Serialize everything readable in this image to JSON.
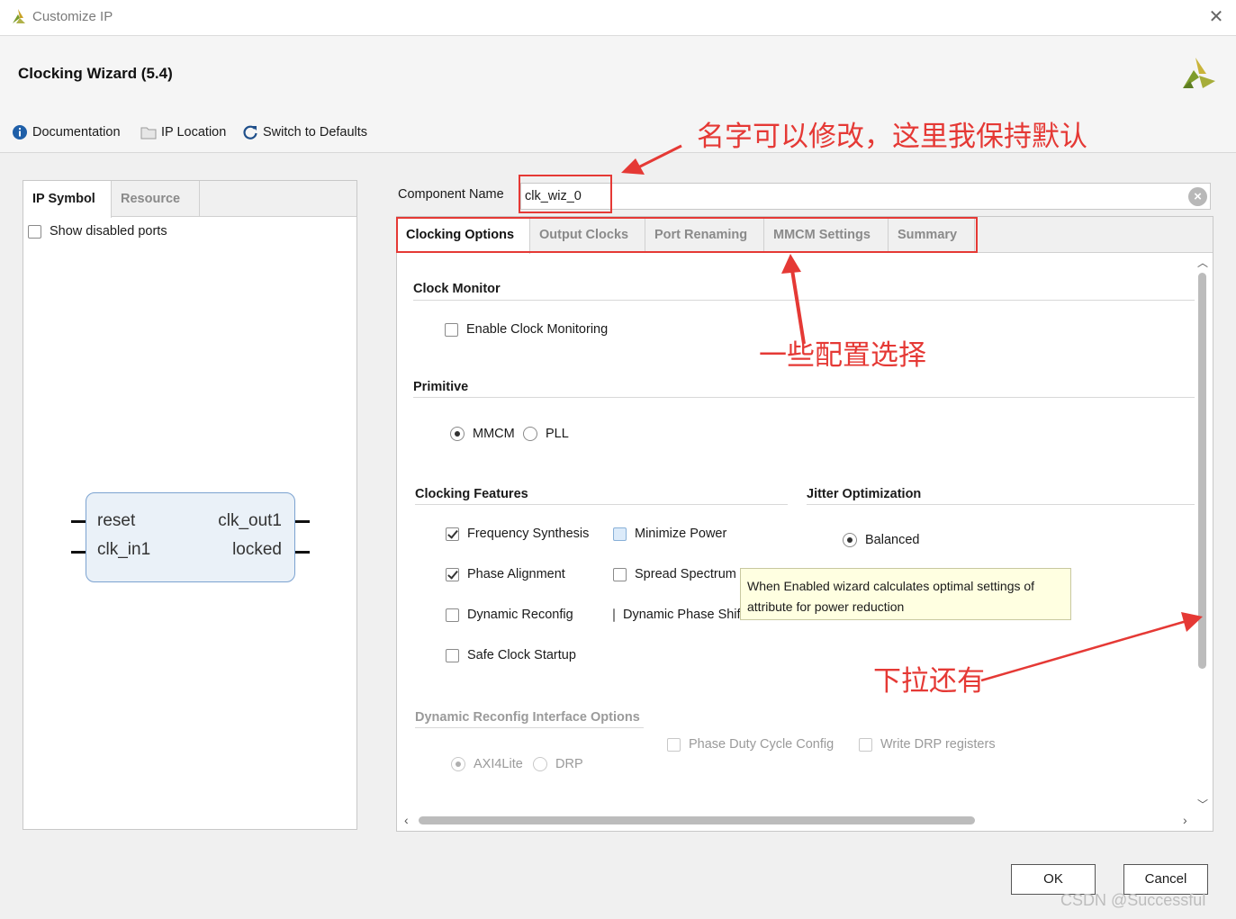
{
  "window": {
    "title": "Customize IP",
    "close_glyph": "✕"
  },
  "header": {
    "title": "Clocking Wizard (5.4)",
    "toolbar": [
      {
        "label": "Documentation",
        "icon": "info-icon"
      },
      {
        "label": "IP Location",
        "icon": "folder-icon"
      },
      {
        "label": "Switch to Defaults",
        "icon": "refresh-icon"
      }
    ]
  },
  "left_panel": {
    "tabs": [
      "IP Symbol",
      "Resource"
    ],
    "show_disabled_ports": {
      "label": "Show disabled ports",
      "checked": false
    },
    "ip_symbol": {
      "left_ports": [
        "reset",
        "clk_in1"
      ],
      "right_ports": [
        "clk_out1",
        "locked"
      ]
    }
  },
  "component": {
    "label": "Component Name",
    "value": "clk_wiz_0",
    "clear_icon": "clear-icon"
  },
  "tabs": [
    "Clocking Options",
    "Output Clocks",
    "Port Renaming",
    "MMCM Settings",
    "Summary"
  ],
  "active_tab": "Clocking Options",
  "clock_monitor": {
    "title": "Clock Monitor",
    "enable": {
      "label": "Enable Clock Monitoring",
      "checked": false
    }
  },
  "primitive": {
    "title": "Primitive",
    "options": [
      {
        "label": "MMCM",
        "selected": true
      },
      {
        "label": "PLL",
        "selected": false
      }
    ]
  },
  "clocking_features": {
    "title": "Clocking Features",
    "col1": [
      {
        "label": "Frequency Synthesis",
        "checked": true
      },
      {
        "label": "Phase Alignment",
        "checked": true
      },
      {
        "label": "Dynamic Reconfig",
        "checked": false
      },
      {
        "label": "Safe Clock Startup",
        "checked": false
      }
    ],
    "col2": [
      {
        "label": "Minimize Power",
        "checked": false,
        "hover": true
      },
      {
        "label": "Spread Spectrum",
        "checked": false
      },
      {
        "label": "Dynamic Phase Shift",
        "checked": false
      }
    ]
  },
  "jitter": {
    "title": "Jitter Optimization",
    "options": [
      {
        "label": "Balanced",
        "selected": true
      }
    ]
  },
  "tooltip": "When Enabled wizard calculates optimal settings of attribute for power reduction",
  "drp": {
    "title": "Dynamic Reconfig Interface Options",
    "interface": [
      {
        "label": "AXI4Lite",
        "selected": true
      },
      {
        "label": "DRP",
        "selected": false
      }
    ],
    "extras": [
      {
        "label": "Phase Duty Cycle Config",
        "checked": false
      },
      {
        "label": "Write DRP registers",
        "checked": false
      }
    ]
  },
  "buttons": {
    "ok": "OK",
    "cancel": "Cancel"
  },
  "annotations": {
    "name": "名字可以修改，这里我保持默认",
    "config": "一些配置选择",
    "scroll": "下拉还有",
    "color": "#e53935"
  },
  "watermark": "CSDN @Successful"
}
